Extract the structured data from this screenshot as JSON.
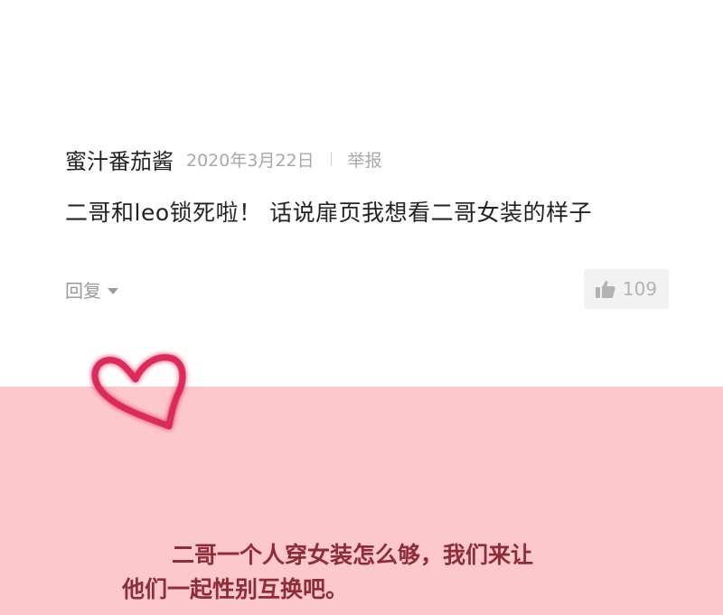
{
  "comment": {
    "username": "蜜汁番茄酱",
    "date": "2020年3月22日",
    "report_label": "举报",
    "text": "二哥和leo锁死啦！ 话说扉页我想看二哥女装的样子",
    "reply_label": "回复",
    "like_count": "109",
    "like_icon": "thumbs-up-icon",
    "reply_icon": "caret-down-icon"
  },
  "banner": {
    "caption_line1": "二哥一个人穿女装怎么够，我们来让",
    "caption_line2": "他们一起性别互换吧。",
    "heart_icon": "heart-icon",
    "background_color": "#fcc8cc",
    "caption_color": "#8e2c38",
    "heart_color": "#dc2a5a"
  }
}
